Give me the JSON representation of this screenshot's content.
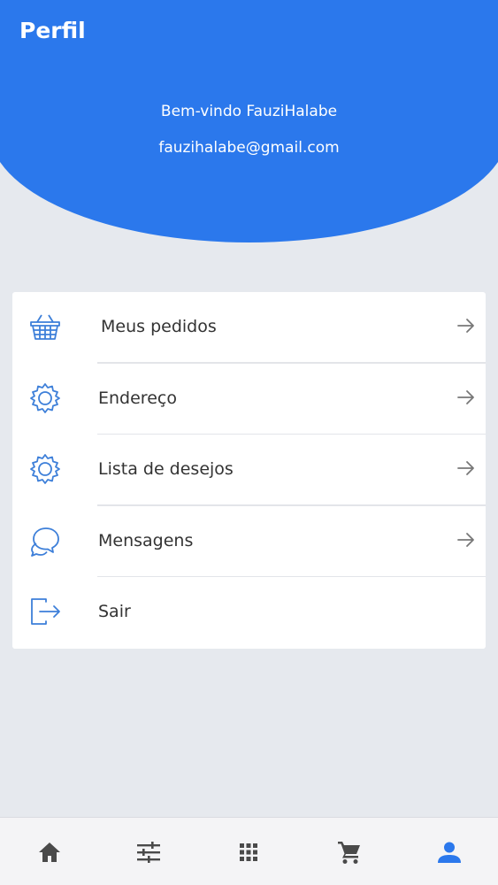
{
  "header": {
    "title": "Perfil",
    "welcome": "Bem-vindo FauziHalabe",
    "email": "fauzihalabe@gmail.com"
  },
  "menu": {
    "items": [
      {
        "label": "Meus pedidos",
        "icon": "basket-icon",
        "has_arrow": true
      },
      {
        "label": "Endereço",
        "icon": "gear-icon",
        "has_arrow": true
      },
      {
        "label": "Lista de desejos",
        "icon": "gear-icon",
        "has_arrow": true
      },
      {
        "label": "Mensagens",
        "icon": "chat-bubbles-icon",
        "has_arrow": true
      },
      {
        "label": "Sair",
        "icon": "logout-icon",
        "has_arrow": false
      }
    ]
  },
  "bottom_nav": {
    "items": [
      {
        "icon": "home-icon",
        "active": false
      },
      {
        "icon": "sliders-icon",
        "active": false
      },
      {
        "icon": "grid-icon",
        "active": false
      },
      {
        "icon": "cart-icon",
        "active": false
      },
      {
        "icon": "person-icon",
        "active": true
      }
    ]
  },
  "colors": {
    "primary": "#2b78ec",
    "icon_blue": "#3d7fd9",
    "nav_inactive": "#4a4a4a",
    "background": "#e6e9ee",
    "text": "#333333"
  }
}
